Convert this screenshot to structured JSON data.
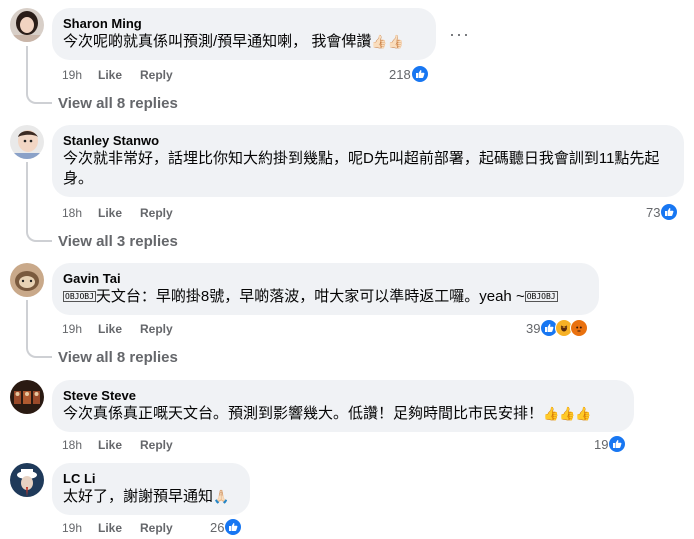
{
  "comments": [
    {
      "author": "Sharon Ming",
      "text": "今次呢啲就真係叫預測/預早通知喇， 我會俾讚",
      "emoji": "👍🏻👍🏻",
      "time": "19h",
      "like": "Like",
      "reply": "Reply",
      "reaction_count": "218",
      "view_replies": "View all 8 replies",
      "more": "···"
    },
    {
      "author": "Stanley Stanwo",
      "text": "今次就非常好，話埋比你知大約掛到幾點，呢D先叫超前部署，起碼聽日我會訓到11點先起身。",
      "time": "18h",
      "like": "Like",
      "reply": "Reply",
      "reaction_count": "73",
      "view_replies": "View all 3 replies"
    },
    {
      "author": "Gavin Tai",
      "text": "天文台：早啲掛8號，早啲落波，咁大家可以準時返工囉。yeah ~",
      "glyph_prefix": "OBJOBJ",
      "glyph_suffix": "OBJOBJ",
      "time": "19h",
      "like": "Like",
      "reply": "Reply",
      "reaction_count": "39",
      "view_replies": "View all 8 replies"
    },
    {
      "author": "Steve Steve",
      "text": "今次真係真正嘅天文台。預測到影響幾大。低讚！足夠時間比市民安排！",
      "emoji": "👍👍👍",
      "time": "18h",
      "like": "Like",
      "reply": "Reply",
      "reaction_count": "19"
    },
    {
      "author": "LC Li",
      "text": "太好了，謝謝預早通知",
      "emoji": "🙏🏻",
      "time": "19h",
      "like": "Like",
      "reply": "Reply",
      "reaction_count": "26"
    }
  ],
  "colors": {
    "bubble": "#f0f2f5",
    "like_blue": "#1877f2",
    "muted": "#65676b"
  }
}
